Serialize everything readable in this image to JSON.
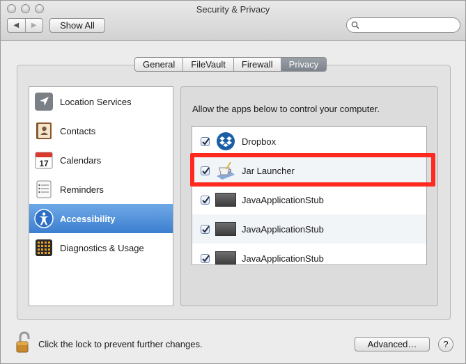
{
  "window": {
    "title": "Security & Privacy"
  },
  "toolbar": {
    "back_glyph": "◀",
    "forward_glyph": "▶",
    "show_all_label": "Show All",
    "search_placeholder": ""
  },
  "tabs": [
    {
      "label": "General",
      "active": false
    },
    {
      "label": "FileVault",
      "active": false
    },
    {
      "label": "Firewall",
      "active": false
    },
    {
      "label": "Privacy",
      "active": true
    }
  ],
  "sidebar": {
    "items": [
      {
        "label": "Location Services",
        "icon": "location-arrow-icon"
      },
      {
        "label": "Contacts",
        "icon": "contacts-book-icon"
      },
      {
        "label": "Calendars",
        "icon": "calendar-icon",
        "calendar_day": "17"
      },
      {
        "label": "Reminders",
        "icon": "reminders-list-icon"
      },
      {
        "label": "Accessibility",
        "icon": "accessibility-icon",
        "selected": true
      },
      {
        "label": "Diagnostics & Usage",
        "icon": "diagnostics-grid-icon"
      }
    ]
  },
  "main": {
    "instruction": "Allow the apps below to control your computer.",
    "apps": [
      {
        "name": "Dropbox",
        "checked": true,
        "icon": "dropbox-icon"
      },
      {
        "name": "Jar Launcher",
        "checked": true,
        "icon": "java-cup-icon",
        "highlighted": true
      },
      {
        "name": "JavaApplicationStub",
        "checked": true,
        "icon": "app-stub-icon"
      },
      {
        "name": "JavaApplicationStub",
        "checked": true,
        "icon": "app-stub-icon"
      },
      {
        "name": "JavaApplicationStub",
        "checked": true,
        "icon": "app-stub-icon"
      }
    ]
  },
  "footer": {
    "lock_text": "Click the lock to prevent further changes.",
    "advanced_label": "Advanced…",
    "help_label": "?"
  },
  "colors": {
    "selection": "#3c7fd0",
    "highlight_box": "#ff2a1f",
    "active_tab": "#7c838c"
  }
}
